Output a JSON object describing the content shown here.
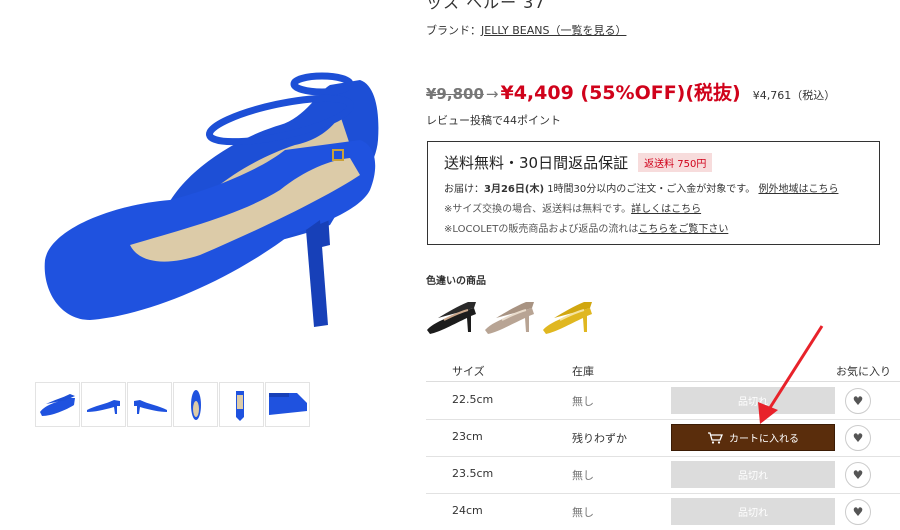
{
  "product": {
    "title_partial": "ッス ヘルー 37",
    "brand_label": "ブランド：",
    "brand_link": "JELLY BEANS（一覧を見る）"
  },
  "price": {
    "old": "¥9,800",
    "arrow": "→",
    "new": "¥4,409 (55%OFF)(税抜)",
    "incl_tax": "¥4,761（税込）"
  },
  "review_text": "レビュー投稿で44ポイント",
  "shipping": {
    "title": "送料無料・30日間返品保証",
    "return_badge": "返送料 750円",
    "delivery_prefix": "お届け：",
    "delivery_date": "3月26日(木)",
    "delivery_desc": " 1時間30分以内のご注文・ご入金が対象です。",
    "delivery_link": "例外地域はこちら",
    "exchange_text": "※サイズ交換の場合、返送料は無料です。",
    "exchange_link": "詳しくはこちら",
    "locolet_text": "※LOCOLETの販売商品および返品の流れは",
    "locolet_link": "こちらをご覧下さい"
  },
  "colors": {
    "label": "色違いの商品",
    "items": [
      {
        "name": "black-pump",
        "color": "#1c1c1c"
      },
      {
        "name": "beige-pump",
        "color": "#b8a494"
      },
      {
        "name": "yellow-pump",
        "color": "#e0b720"
      }
    ]
  },
  "table": {
    "headers": {
      "size": "サイズ",
      "stock": "在庫",
      "fav": "お気に入り"
    },
    "rows": [
      {
        "size": "22.5cm",
        "stock": "無し",
        "button": "品切れ",
        "available": false
      },
      {
        "size": "23cm",
        "stock": "残りわずか",
        "button": "カートに入れる",
        "available": true
      },
      {
        "size": "23.5cm",
        "stock": "無し",
        "button": "品切れ",
        "available": false
      },
      {
        "size": "24cm",
        "stock": "無し",
        "button": "品切れ",
        "available": false
      }
    ]
  },
  "colors_theme": {
    "price_red": "#d0021b",
    "cart_brown": "#5a2d0c",
    "shoe_blue": "#1b4fd8",
    "annotation_red": "#e8222a"
  }
}
